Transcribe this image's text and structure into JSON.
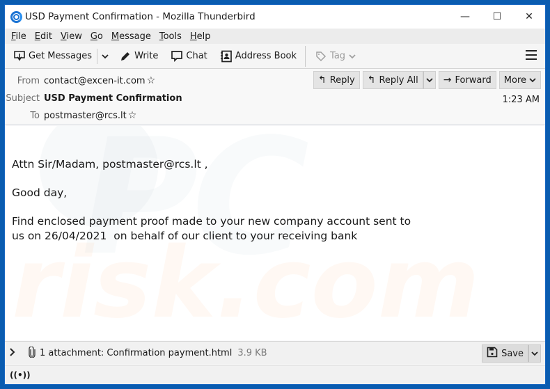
{
  "window": {
    "title": "USD Payment Confirmation - Mozilla Thunderbird",
    "controls": {
      "minimize": "—",
      "maximize": "☐",
      "close": "✕"
    }
  },
  "menubar": {
    "items": [
      {
        "accel": "F",
        "rest": "ile"
      },
      {
        "accel": "E",
        "rest": "dit"
      },
      {
        "accel": "V",
        "rest": "iew"
      },
      {
        "accel": "G",
        "rest": "o"
      },
      {
        "accel": "M",
        "rest": "essage"
      },
      {
        "accel": "T",
        "rest": "ools"
      },
      {
        "accel": "H",
        "rest": "elp"
      }
    ]
  },
  "toolbar": {
    "get_messages": "Get Messages",
    "write": "Write",
    "chat": "Chat",
    "address_book": "Address Book",
    "tag": "Tag"
  },
  "header": {
    "from_label": "From",
    "from_value": "contact@excen-it.com",
    "subject_label": "Subject",
    "subject_value": "USD Payment Confirmation",
    "to_label": "To",
    "to_value": "postmaster@rcs.lt",
    "time": "1:23 AM",
    "actions": {
      "reply": "Reply",
      "reply_all": "Reply All",
      "forward": "Forward",
      "more": "More"
    }
  },
  "body": {
    "paragraphs": [
      "Attn Sir/Madam, postmaster@rcs.lt ,",
      "Good day,",
      "Find enclosed payment proof made to your new company account sent to",
      "us on 26/04/2021  on behalf of our client to your receiving bank"
    ],
    "watermark_top": "PC",
    "watermark_bottom": "risk.com"
  },
  "attachments": {
    "label": "1 attachment: Confirmation payment.html",
    "size": "3.9 KB",
    "save": "Save"
  },
  "status": {
    "icon_glyph": "((•))"
  }
}
